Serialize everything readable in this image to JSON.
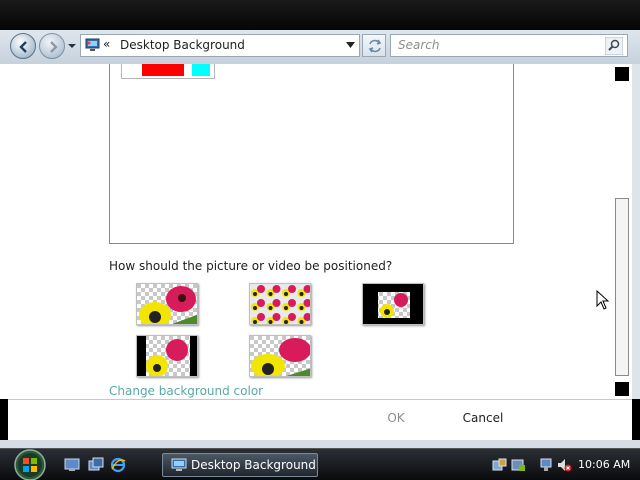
{
  "address_bar": {
    "chevron": "«",
    "location": "Desktop Background",
    "search_placeholder": "Search"
  },
  "icons": {
    "back": "back-arrow-icon",
    "forward": "forward-arrow-icon",
    "refresh": "refresh-icon",
    "search": "search-icon",
    "folder": "control-panel-icon"
  },
  "content": {
    "position_question": "How should the picture or video be positioned?",
    "position_options": [
      "fill",
      "tile",
      "center",
      "fit",
      "stretch"
    ],
    "change_background_link": "Change background color"
  },
  "footer": {
    "ok_label": "OK",
    "cancel_label": "Cancel"
  },
  "taskbar": {
    "active_window_label": "Desktop Background",
    "clock": "10:06 AM"
  },
  "colors": {
    "link": "#5aa9a4",
    "disabled_text": "#8d8d8d"
  }
}
